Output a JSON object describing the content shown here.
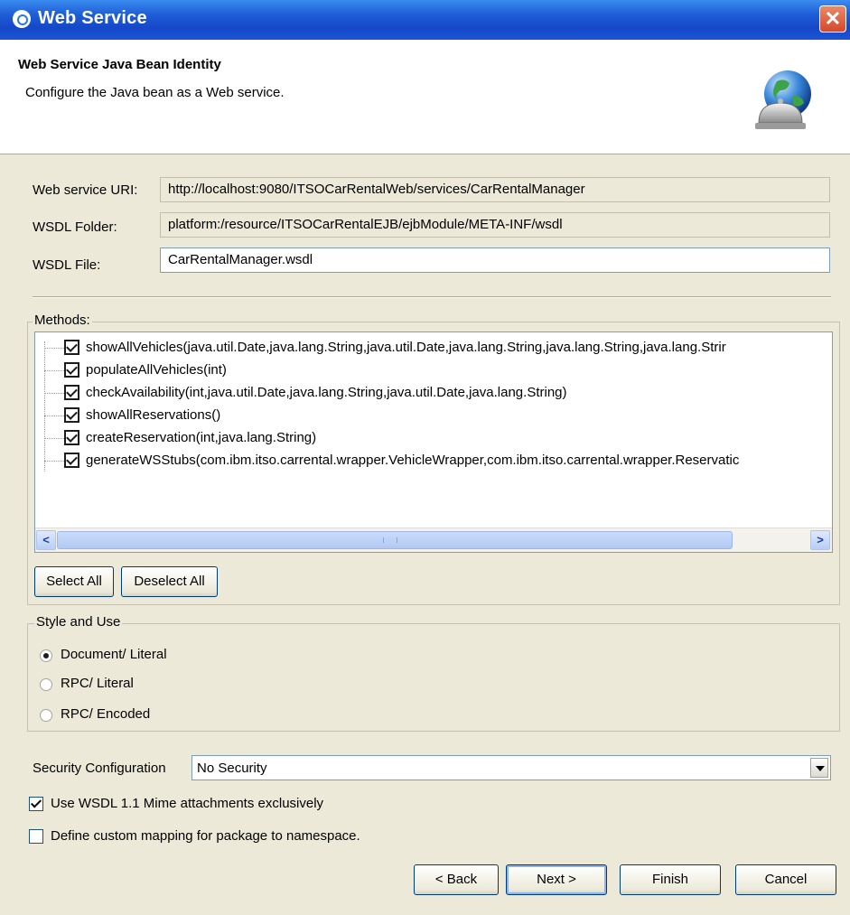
{
  "window": {
    "title": "Web Service",
    "close_glyph": "✕"
  },
  "banner": {
    "heading": "Web Service Java Bean Identity",
    "description": "Configure the Java bean as a Web service.",
    "icon": "globe-bell-icon"
  },
  "fields": {
    "uri_label": "Web service URI:",
    "uri_value": "http://localhost:9080/ITSOCarRentalWeb/services/CarRentalManager",
    "folder_label": "WSDL Folder:",
    "folder_value": "platform:/resource/ITSOCarRentalEJB/ejbModule/META-INF/wsdl",
    "file_label": "WSDL File:",
    "file_value": "CarRentalManager.wsdl"
  },
  "methods": {
    "label": "Methods:",
    "items": [
      "showAllVehicles(java.util.Date,java.lang.String,java.util.Date,java.lang.String,java.lang.String,java.lang.Strir",
      "populateAllVehicles(int)",
      "checkAvailability(int,java.util.Date,java.lang.String,java.util.Date,java.lang.String)",
      "showAllReservations()",
      "createReservation(int,java.lang.String)",
      "generateWSStubs(com.ibm.itso.carrental.wrapper.VehicleWrapper,com.ibm.itso.carrental.wrapper.Reservatic"
    ],
    "scroll_left": "<",
    "scroll_right": ">",
    "select_all": "Select All",
    "deselect_all": "Deselect All"
  },
  "style": {
    "label": "Style and Use",
    "options": [
      "Document/ Literal",
      "RPC/ Literal",
      "RPC/ Encoded"
    ],
    "selected": "Document/ Literal"
  },
  "security": {
    "label": "Security Configuration",
    "value": "No Security"
  },
  "options": {
    "mime_label": "Use WSDL 1.1 Mime attachments exclusively",
    "mime_checked": true,
    "mapping_label": "Define custom mapping for package to namespace.",
    "mapping_checked": false
  },
  "buttons": {
    "back": "< Back",
    "next": "Next >",
    "finish": "Finish",
    "cancel": "Cancel"
  },
  "colors": {
    "titlebar": "#1f5fd8",
    "dialog_bg": "#ece9d8",
    "close_button": "#d5482a"
  }
}
